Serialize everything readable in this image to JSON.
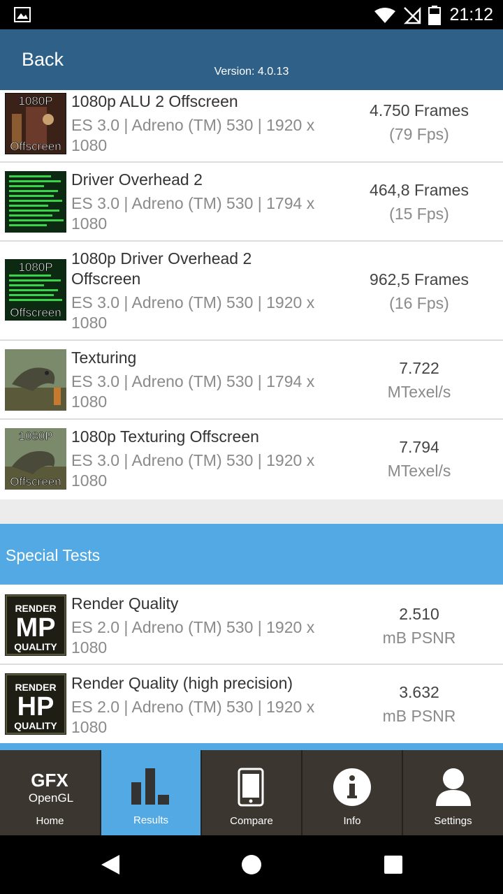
{
  "status_bar": {
    "time": "21:12"
  },
  "header": {
    "back_label": "Back",
    "version": "Version: 4.0.13"
  },
  "rows": [
    {
      "title": "1080p ALU 2 Offscreen",
      "sub1": "ES 3.0 | Adreno (TM) 530 | 1920 x",
      "sub2": "1080",
      "value": "4.750 Frames",
      "unit": "(79 Fps)",
      "badge_top": "1080P",
      "badge_bottom": "Offscreen"
    },
    {
      "title": "Driver Overhead 2",
      "sub1": "ES 3.0 | Adreno (TM) 530 | 1794 x",
      "sub2": "1080",
      "value": "464,8 Frames",
      "unit": "(15 Fps)"
    },
    {
      "title": "1080p Driver Overhead 2",
      "title2": "Offscreen",
      "sub1": "ES 3.0 | Adreno (TM) 530 | 1920 x",
      "sub2": "1080",
      "value": "962,5 Frames",
      "unit": "(16 Fps)",
      "badge_top": "1080P",
      "badge_bottom": "Offscreen"
    },
    {
      "title": "Texturing",
      "sub1": "ES 3.0 | Adreno (TM) 530 | 1794 x",
      "sub2": "1080",
      "value": "7.722",
      "unit": "MTexel/s"
    },
    {
      "title": "1080p Texturing Offscreen",
      "sub1": "ES 3.0 | Adreno (TM) 530 | 1920 x",
      "sub2": "1080",
      "value": "7.794",
      "unit": "MTexel/s",
      "badge_top": "1080P",
      "badge_bottom": "Offscreen"
    }
  ],
  "section_title": "Special Tests",
  "special_rows": [
    {
      "title": "Render Quality",
      "sub1": "ES 2.0 | Adreno (TM) 530 | 1920 x",
      "sub2": "1080",
      "value": "2.510",
      "unit": "mB PSNR",
      "badge_top": "RENDER",
      "badge_mid": "MP",
      "badge_bottom": "QUALITY"
    },
    {
      "title": "Render Quality (high precision)",
      "sub1": "ES 2.0 | Adreno (TM) 530 | 1920 x",
      "sub2": "1080",
      "value": "3.632",
      "unit": "mB PSNR",
      "badge_top": "RENDER",
      "badge_mid": "HP",
      "badge_bottom": "QUALITY"
    }
  ],
  "tabs": [
    {
      "label": "Home",
      "logo_top": "GFX",
      "logo_bottom": "OpenGL",
      "icon": "gfx-logo-icon"
    },
    {
      "label": "Results",
      "icon": "bar-chart-icon",
      "active": true
    },
    {
      "label": "Compare",
      "icon": "phone-icon"
    },
    {
      "label": "Info",
      "icon": "info-icon"
    },
    {
      "label": "Settings",
      "icon": "user-icon"
    }
  ],
  "colors": {
    "header": "#2e6088",
    "accent": "#52a9e4",
    "tab_bg": "#3b3630"
  }
}
